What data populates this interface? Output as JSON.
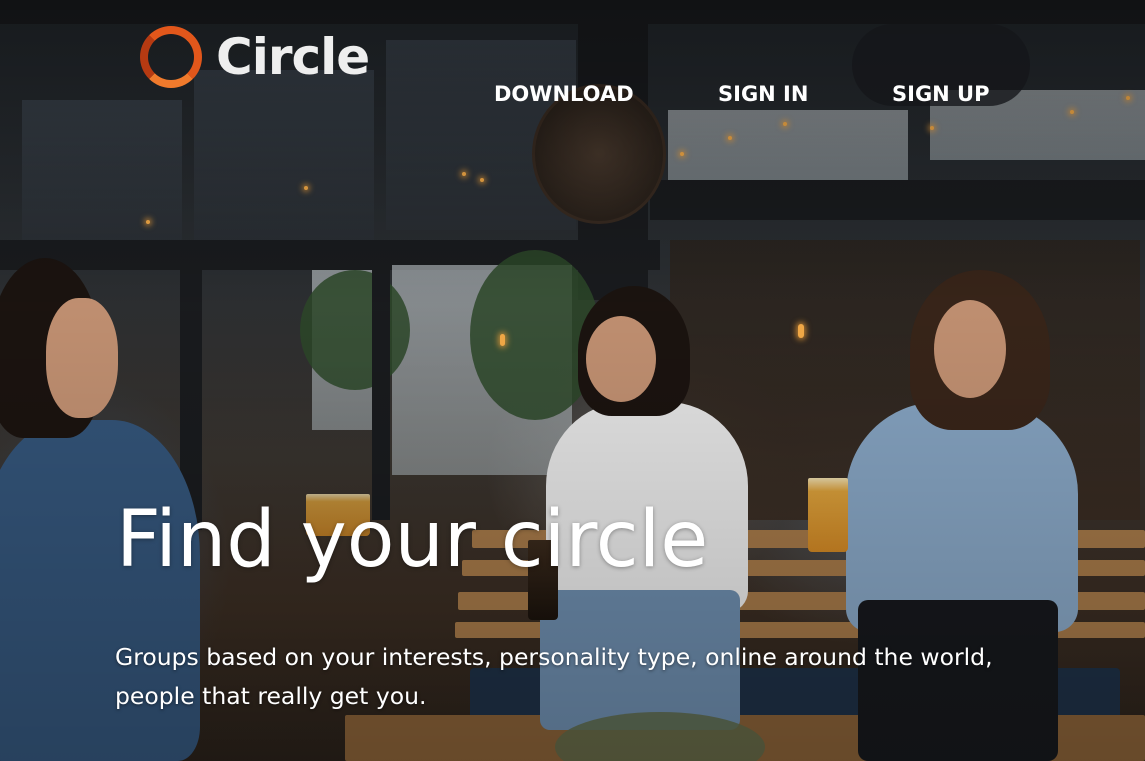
{
  "brand": {
    "name": "Circle",
    "accent": "#e2571b"
  },
  "nav": {
    "download": "DOWNLOAD",
    "sign_in": "SIGN IN",
    "sign_up": "SIGN UP"
  },
  "hero": {
    "headline": "Find your circle",
    "subtext": "Groups based on your interests, personality type, online around the world, people that really get you.",
    "background_image": "photo of three friends laughing on a bench outside a bar"
  }
}
